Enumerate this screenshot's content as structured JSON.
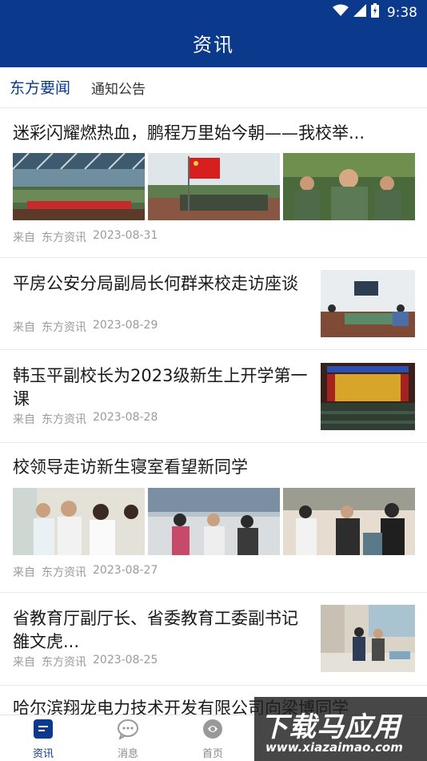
{
  "status_bar": {
    "time": "9:38",
    "icons": [
      "wifi-icon",
      "cellular-signal-icon",
      "battery-icon"
    ]
  },
  "app_bar": {
    "title": "资讯"
  },
  "tabs": [
    {
      "label": "东方要闻",
      "active": true
    },
    {
      "label": "通知公告",
      "active": false
    }
  ],
  "news": [
    {
      "title": "迷彩闪耀燃热血，鹏程万里始今朝——我校举...",
      "source_prefix": "来自",
      "source": "东方资讯",
      "date": "2023-08-31",
      "layout": "three-images"
    },
    {
      "title": "平房公安分局副局长何群来校走访座谈",
      "source_prefix": "来自",
      "source": "东方资讯",
      "date": "2023-08-29",
      "layout": "thumbnail"
    },
    {
      "title": "韩玉平副校长为2023级新生上开学第一课",
      "source_prefix": "来自",
      "source": "东方资讯",
      "date": "2023-08-28",
      "layout": "thumbnail"
    },
    {
      "title": "校领导走访新生寝室看望新同学",
      "source_prefix": "来自",
      "source": "东方资讯",
      "date": "2023-08-27",
      "layout": "three-images"
    },
    {
      "title": "省教育厅副厅长、省委教育工委副书记雒文虎...",
      "source_prefix": "来自",
      "source": "东方资讯",
      "date": "2023-08-25",
      "layout": "thumbnail"
    },
    {
      "title": "哈尔滨翔龙电力技术开发有限公司向梁博同学",
      "layout": "partial"
    }
  ],
  "bottom_nav": [
    {
      "label": "资讯",
      "icon": "news-icon",
      "active": true
    },
    {
      "label": "消息",
      "icon": "chat-bubble-icon",
      "active": false
    },
    {
      "label": "首页",
      "icon": "home-logo-icon",
      "active": false
    }
  ],
  "watermark": {
    "text": "下载马应用",
    "url": "www.xiazaimao.com"
  },
  "colors": {
    "primary": "#0b3a8c",
    "meta_text": "#9a9a9a",
    "divider": "#e9e9e9"
  }
}
